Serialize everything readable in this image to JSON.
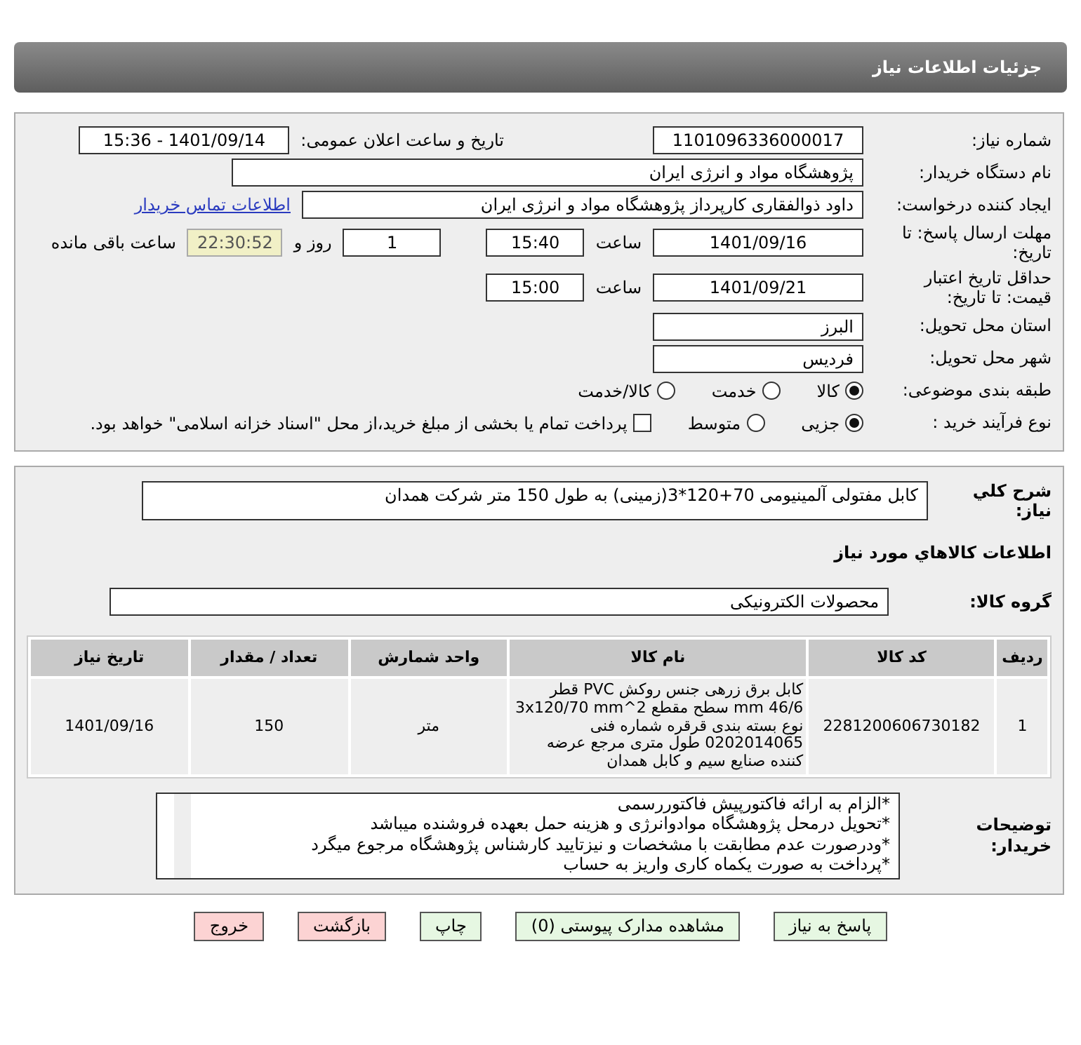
{
  "header": {
    "title": "جزئیات اطلاعات نیاز"
  },
  "need_number": {
    "label": "شماره نیاز:",
    "value": "1101096336000017"
  },
  "announce": {
    "label": "تاریخ و ساعت اعلان عمومی:",
    "value": "1401/09/14 - 15:36"
  },
  "buyer_org": {
    "label": "نام دستگاه خریدار:",
    "value": "پژوهشگاه مواد و انرژی ایران"
  },
  "requester": {
    "label": "ایجاد کننده درخواست:",
    "value": "داود ذوالفقاری کارپرداز پژوهشگاه مواد و انرژی ایران",
    "link": "اطلاعات تماس خریدار"
  },
  "deadline": {
    "label": "مهلت ارسال پاسخ: تا تاریخ:",
    "date": "1401/09/16",
    "time_label": "ساعت",
    "time": "15:40",
    "days": "1",
    "days_label": "روز و",
    "remaining": "22:30:52",
    "remaining_label": "ساعت باقی مانده"
  },
  "validity": {
    "label": "حداقل تاریخ اعتبار قیمت: تا تاریخ:",
    "date": "1401/09/21",
    "time_label": "ساعت",
    "time": "15:00"
  },
  "province": {
    "label": "استان محل تحویل:",
    "value": "البرز"
  },
  "city": {
    "label": "شهر محل تحویل:",
    "value": "فردیس"
  },
  "category": {
    "label": "طبقه بندی موضوعی:",
    "options": [
      {
        "label": "کالا",
        "selected": true
      },
      {
        "label": "خدمت",
        "selected": false
      },
      {
        "label": "کالا/خدمت",
        "selected": false
      }
    ]
  },
  "purchase_type": {
    "label": "نوع فرآیند خرید :",
    "options": [
      {
        "label": "جزیی",
        "selected": true
      },
      {
        "label": "متوسط",
        "selected": false
      }
    ],
    "payment": {
      "label": "پرداخت تمام یا بخشی از مبلغ خرید،از محل \"اسناد خزانه اسلامی\" خواهد بود.",
      "checked": false
    }
  },
  "description": {
    "label": "شرح کلي نياز:",
    "value": "کابل  مفتولی آلمینیومی 70+120*3(زمینی) به طول 150 متر شرکت همدان"
  },
  "goods_title": "اطلاعات کالاهاي مورد نياز",
  "group": {
    "label": "گروه کالا:",
    "value": "محصولات الکترونیکی"
  },
  "table": {
    "columns": [
      "ردیف",
      "کد کالا",
      "نام کالا",
      "واحد شمارش",
      "تعداد / مقدار",
      "تاریخ نیاز"
    ],
    "rows": [
      [
        "1",
        "2281200606730182",
        "کابل برق زرهی جنس روکش PVC قطر 46/6 mm سطح مقطع 3x120/70 mm^2 نوع بسته بندی قرقره شماره فنی 0202014065 طول متری مرجع عرضه کننده صنایع سیم و کابل همدان",
        "متر",
        "150",
        "1401/09/16"
      ]
    ]
  },
  "notes": {
    "label": "توضیحات خریدار:",
    "lines": [
      "*الزام به ارائه فاکتورپیش فاکتوررسمی",
      "*تحویل درمحل پژوهشگاه موادوانرژی و هزینه حمل بعهده فروشنده میباشد",
      "*ودرصورت عدم مطابقت با مشخصات و نیزتایید کارشناس پژوهشگاه مرجوع میگرد",
      "*پرداخت به صورت یکماه کاری واریز به حساب"
    ]
  },
  "buttons": [
    {
      "label": "پاسخ به نیاز",
      "kind": "normal"
    },
    {
      "label": "مشاهده مدارک پیوستی (0)",
      "kind": "normal"
    },
    {
      "label": "چاپ",
      "kind": "normal"
    },
    {
      "label": "بازگشت",
      "kind": "danger"
    },
    {
      "label": "خروج",
      "kind": "danger"
    }
  ]
}
